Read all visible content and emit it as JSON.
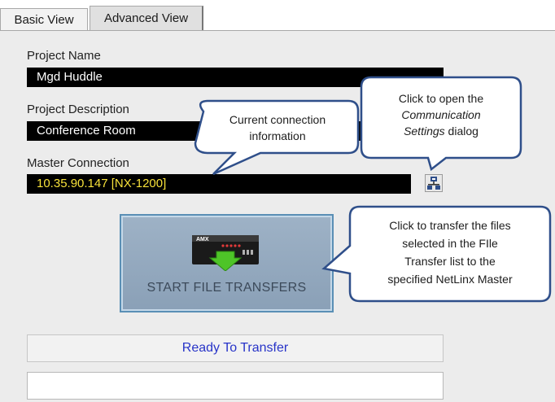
{
  "tabs": [
    {
      "label": "Basic View"
    },
    {
      "label": "Advanced View"
    }
  ],
  "project_name": {
    "label": "Project Name",
    "value": "Mgd Huddle"
  },
  "project_description": {
    "label": "Project Description",
    "value": "Conference Room"
  },
  "master_connection": {
    "label": "Master Connection",
    "value": "10.35.90.147 [NX-1200]"
  },
  "transfer_button": {
    "label": "START FILE TRANSFERS",
    "device_brand": "AMX"
  },
  "status": {
    "text": "Ready To Transfer"
  },
  "callouts": {
    "connection": {
      "line1": "Current connection",
      "line2": "information"
    },
    "comm_settings": {
      "line1": "Click to open the",
      "line2_italic": "Communication",
      "line3_italic": "Settings",
      "line3_rest": " dialog"
    },
    "transfer": {
      "line1": "Click to transfer the files",
      "line2": "selected in the FIle",
      "line3": "Transfer list to the",
      "line4": "specified NetLinx Master"
    }
  },
  "colors": {
    "field_bg": "#000000",
    "master_text": "#f7e13a",
    "status_text": "#2834c8",
    "callout_border": "#2f4f8a",
    "button_bg": "#9eb2c6"
  }
}
